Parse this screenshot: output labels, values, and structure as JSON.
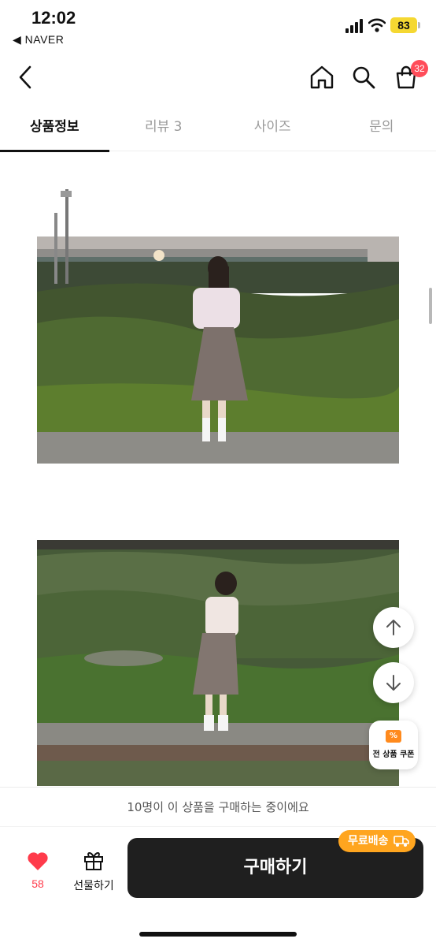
{
  "status_bar": {
    "time": "12:02",
    "back_app": "◀ NAVER",
    "battery": "83"
  },
  "header": {
    "cart_count": "32"
  },
  "tabs": [
    {
      "label": "상품정보",
      "active": true
    },
    {
      "label": "리뷰 3",
      "active": false
    },
    {
      "label": "사이즈",
      "active": false
    },
    {
      "label": "문의",
      "active": false
    }
  ],
  "coupon": {
    "label": "전 상품 쿠폰"
  },
  "notice": {
    "text": "10명이 이 상품을 구매하는 중이에요"
  },
  "bottom_bar": {
    "like_count": "58",
    "gift_label": "선물하기",
    "buy_label": "구매하기",
    "free_shipping": "무료배송"
  },
  "colors": {
    "accent_red": "#ff3b4b",
    "buy_button": "#1f1f1f",
    "free_shipping_badge": "#ffa51f",
    "battery": "#f5d832"
  }
}
